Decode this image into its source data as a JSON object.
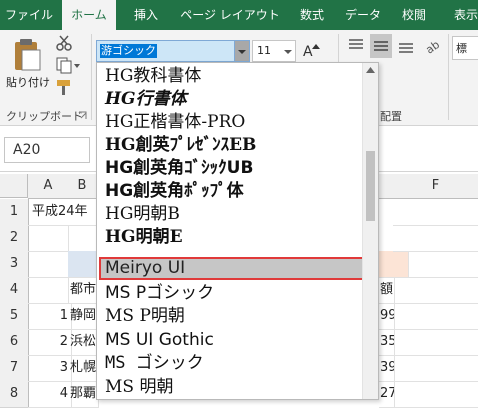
{
  "ribbon": {
    "tabs": [
      {
        "label": "ファイル"
      },
      {
        "label": "ホーム"
      },
      {
        "label": "挿入"
      },
      {
        "label": "ページ レイアウト"
      },
      {
        "label": "数式"
      },
      {
        "label": "データ"
      },
      {
        "label": "校閲"
      },
      {
        "label": "表示"
      }
    ],
    "active_tab": "ホーム",
    "clipboard": {
      "paste_label": "貼り付け",
      "group_label": "クリップボード"
    },
    "font_group": {
      "font_name": "游ゴシック",
      "font_size": "11"
    },
    "alignment_group": {
      "group_label": "配置"
    },
    "number_group": {
      "format": "標"
    },
    "colors": {
      "tab_bar": "#217346",
      "accent": "#217346"
    }
  },
  "name_box": {
    "value": "A20"
  },
  "sheet": {
    "columns": [
      "A",
      "B",
      "F"
    ],
    "rows": [
      "1",
      "2",
      "3",
      "4",
      "5",
      "6",
      "7",
      "8"
    ],
    "cells": {
      "A1": "平成24年",
      "B1": "（",
      "B4": "都市",
      "A5": "1",
      "B5": "静岡",
      "A6": "2",
      "B6": "浜松",
      "A7": "3",
      "B7": "札幌",
      "A8": "4",
      "B8": "那覇",
      "E4": "額",
      "E5": "99",
      "E6": "35",
      "E7": "39",
      "E8": "27"
    }
  },
  "font_dropdown": {
    "items": [
      "HG教科書体",
      "HG行書体",
      "HG正楷書体-PRO",
      "HG創英ﾌﾟﾚｾﾞﾝｽEB",
      "HG創英角ｺﾞｼｯｸUB",
      "HG創英角ﾎﾟｯﾌﾟ体",
      "HG明朝B",
      "HG明朝E",
      "Meiryo UI",
      "MS Pゴシック",
      "MS P明朝",
      "MS UI Gothic",
      "MS ゴシック",
      "MS 明朝"
    ],
    "selected": "Meiryo UI"
  }
}
